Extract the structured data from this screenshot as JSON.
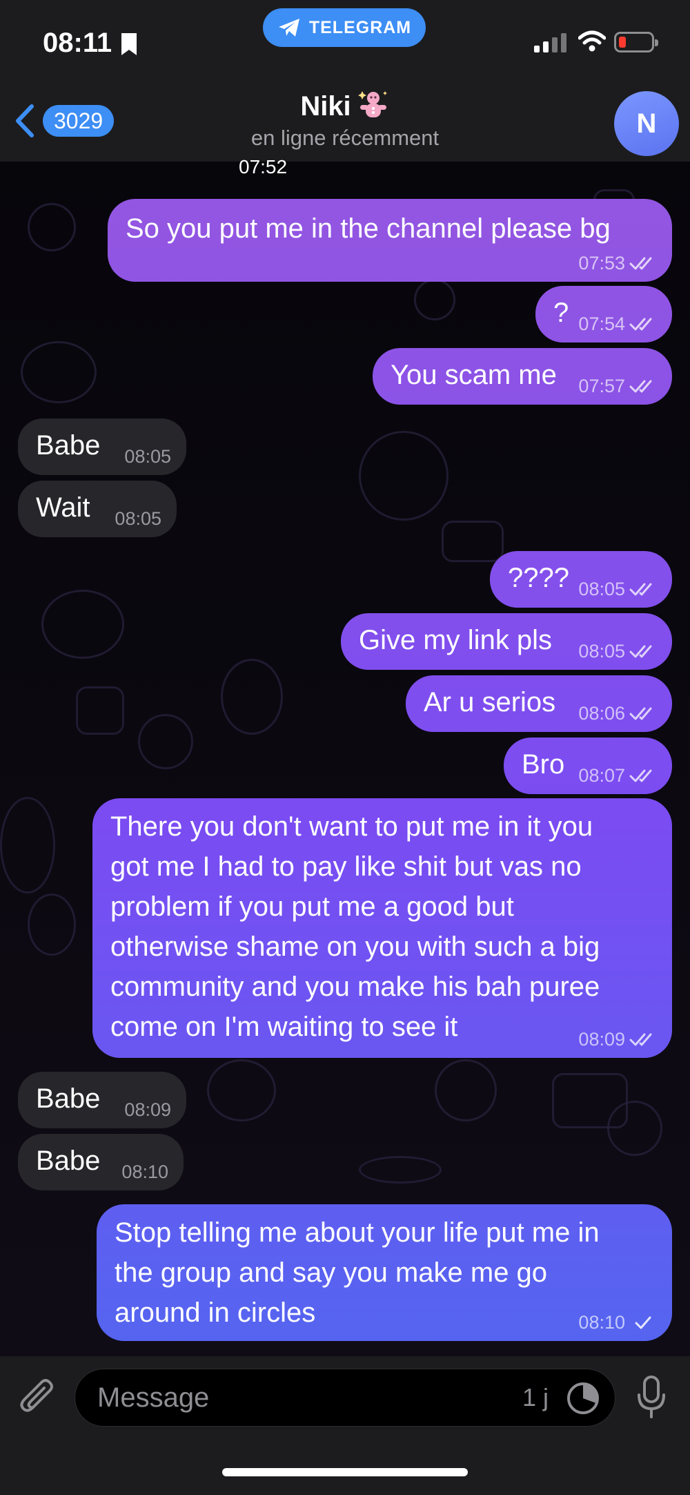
{
  "status_bar": {
    "time": "08:11",
    "app_pill": "TELEGRAM"
  },
  "header": {
    "back_count": "3029",
    "contact_name": "Niki",
    "contact_status": "en ligne récemment",
    "avatar_initial": "N"
  },
  "chat": {
    "date_peek": "07:52",
    "messages": [
      {
        "dir": "out",
        "text": "So you put me in the channel please bg",
        "time": "07:53",
        "read": true
      },
      {
        "dir": "out",
        "text": "?",
        "time": "07:54",
        "read": true
      },
      {
        "dir": "out",
        "text": "You scam me",
        "time": "07:57",
        "read": true
      },
      {
        "dir": "in",
        "text": "Babe",
        "time": "08:05"
      },
      {
        "dir": "in",
        "text": "Wait",
        "time": "08:05"
      },
      {
        "dir": "out",
        "text": "????",
        "time": "08:05",
        "read": true
      },
      {
        "dir": "out",
        "text": "Give my link pls",
        "time": "08:05",
        "read": true
      },
      {
        "dir": "out",
        "text": "Ar u serios",
        "time": "08:06",
        "read": true
      },
      {
        "dir": "out",
        "text": "Bro",
        "time": "08:07",
        "read": true
      },
      {
        "dir": "out",
        "text": "There you don't want to put me in it you\ngot me I had to pay like shit but vas no\nproblem if you put me a good but\notherwise shame on you with such a big\ncommunity and you make his bah puree\ncome on I'm waiting to see it",
        "time": "08:09",
        "read": true
      },
      {
        "dir": "in",
        "text": "Babe",
        "time": "08:09"
      },
      {
        "dir": "in",
        "text": "Babe",
        "time": "08:10"
      },
      {
        "dir": "out",
        "text": "Stop telling me about your life put me in\nthe group and say you make me go\naround in circles",
        "time": "08:10",
        "read": false
      }
    ]
  },
  "input": {
    "placeholder": "Message",
    "timer_label": "1 j"
  },
  "colors": {
    "bubble_top": "#9b59dc",
    "bubble_mid": "#7a4cf2",
    "bubble_bottom": "#4a6cf0",
    "incoming": "#26262b",
    "accent": "#3d8ef5"
  },
  "icons": [
    "bookmark-icon",
    "telegram-plane-icon",
    "signal-icon",
    "wifi-icon",
    "battery-icon",
    "chevron-left-icon",
    "gingerbread-emoji-icon",
    "double-check-icon",
    "single-check-icon",
    "paperclip-icon",
    "timer-icon",
    "microphone-icon"
  ]
}
